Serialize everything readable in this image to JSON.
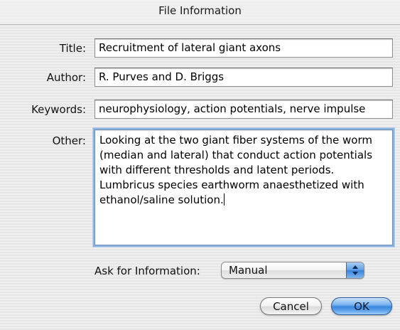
{
  "window": {
    "title": "File Information"
  },
  "fields": {
    "title": {
      "label": "Title:",
      "value": "Recruitment of lateral giant axons"
    },
    "author": {
      "label": "Author:",
      "value": "R. Purves and D. Briggs"
    },
    "keywords": {
      "label": "Keywords:",
      "value": "neurophysiology, action potentials, nerve impulse"
    },
    "other": {
      "label": "Other:",
      "value": "Looking at the two giant fiber systems of the worm (median and lateral) that conduct action potentials with different thresholds and latent periods. Lumbricus species earthworm anaesthetized with ethanol/saline solution."
    }
  },
  "ask": {
    "label": "Ask for Information:",
    "selected": "Manual"
  },
  "buttons": {
    "cancel": "Cancel",
    "ok": "OK"
  },
  "icons": {
    "popup_arrows": "updown-arrows-icon",
    "text_caret": "text-cursor"
  },
  "colors": {
    "focus_ring": "#8fb3e0",
    "default_button": "#3a86dc",
    "window_background": "#ececec"
  }
}
